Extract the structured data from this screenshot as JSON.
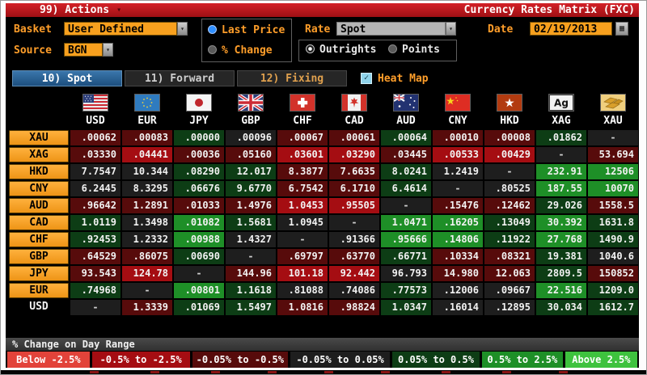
{
  "title_bar": {
    "actions_label": "99) Actions",
    "title": "Currency Rates Matrix (FXC)"
  },
  "controls": {
    "basket_label": "Basket",
    "basket_value": "User Defined",
    "source_label": "Source",
    "source_value": "BGN",
    "price_mode": [
      {
        "label": "Last Price",
        "selected": true
      },
      {
        "label": "% Change",
        "selected": false
      }
    ],
    "rate_label": "Rate",
    "rate_value": "Spot",
    "rate_mode": [
      {
        "label": "Outrights",
        "selected": true
      },
      {
        "label": "Points",
        "selected": false
      }
    ],
    "date_label": "Date",
    "date_value": "02/19/2013"
  },
  "tabs": [
    {
      "name": "tab-spot",
      "label": "10) Spot",
      "active": true
    },
    {
      "name": "tab-forward",
      "label": "11) Forward",
      "active": false
    },
    {
      "name": "tab-fixing",
      "label": "12) Fixing",
      "active": false
    }
  ],
  "heat_map": {
    "label": "Heat Map",
    "checked": true
  },
  "heat_colors": {
    "r2": "#a50d12",
    "r3": "#570b0b",
    "n": "#1e1e1e",
    "g5": "#0d3d15",
    "g6": "#1e8f27"
  },
  "matrix": {
    "columns": [
      "USD",
      "EUR",
      "JPY",
      "GBP",
      "CHF",
      "CAD",
      "AUD",
      "CNY",
      "HKD",
      "XAG",
      "XAU"
    ],
    "rows": [
      {
        "label": "XAU",
        "style": "button",
        "values": [
          ".00062",
          ".00083",
          ".00000",
          ".00096",
          ".00067",
          ".00061",
          ".00064",
          ".00010",
          ".00008",
          ".01862",
          "-"
        ],
        "heat": [
          "r3",
          "r3",
          "g5",
          "n",
          "r3",
          "r3",
          "g5",
          "r3",
          "r3",
          "g5",
          "n"
        ]
      },
      {
        "label": "XAG",
        "style": "button",
        "values": [
          ".03330",
          ".04441",
          ".00036",
          ".05160",
          ".03601",
          ".03290",
          ".03445",
          ".00533",
          ".00429",
          "-",
          "53.694"
        ],
        "heat": [
          "r3",
          "r2",
          "r3",
          "r3",
          "r2",
          "r2",
          "r3",
          "r2",
          "r2",
          "n",
          "r3"
        ]
      },
      {
        "label": "HKD",
        "style": "button",
        "values": [
          "7.7547",
          "10.344",
          ".08290",
          "12.017",
          "8.3877",
          "7.6635",
          "8.0241",
          "1.2419",
          "-",
          "232.91",
          "12506"
        ],
        "heat": [
          "n",
          "n",
          "g5",
          "g5",
          "r3",
          "r3",
          "g5",
          "n",
          "n",
          "g6",
          "g6"
        ]
      },
      {
        "label": "CNY",
        "style": "button",
        "values": [
          "6.2445",
          "8.3295",
          ".06676",
          "9.6770",
          "6.7542",
          "6.1710",
          "6.4614",
          "-",
          ".80525",
          "187.55",
          "10070"
        ],
        "heat": [
          "n",
          "n",
          "g5",
          "g5",
          "r3",
          "r3",
          "g5",
          "n",
          "n",
          "g6",
          "g6"
        ]
      },
      {
        "label": "AUD",
        "style": "button",
        "values": [
          ".96642",
          "1.2891",
          ".01033",
          "1.4976",
          "1.0453",
          ".95505",
          "-",
          ".15476",
          ".12462",
          "29.026",
          "1558.5"
        ],
        "heat": [
          "r3",
          "r3",
          "r3",
          "r3",
          "r2",
          "r2",
          "n",
          "r3",
          "r3",
          "g5",
          "r3"
        ]
      },
      {
        "label": "CAD",
        "style": "button",
        "values": [
          "1.0119",
          "1.3498",
          ".01082",
          "1.5681",
          "1.0945",
          "-",
          "1.0471",
          ".16205",
          ".13049",
          "30.392",
          "1631.8"
        ],
        "heat": [
          "g5",
          "n",
          "g6",
          "g5",
          "n",
          "n",
          "g6",
          "g6",
          "g5",
          "g6",
          "g5"
        ]
      },
      {
        "label": "CHF",
        "style": "button",
        "values": [
          ".92453",
          "1.2332",
          ".00988",
          "1.4327",
          "-",
          ".91366",
          ".95666",
          ".14806",
          ".11922",
          "27.768",
          "1490.9"
        ],
        "heat": [
          "g5",
          "n",
          "g6",
          "n",
          "n",
          "n",
          "g6",
          "g6",
          "g5",
          "g6",
          "g5"
        ]
      },
      {
        "label": "GBP",
        "style": "button",
        "values": [
          ".64529",
          ".86075",
          ".00690",
          "-",
          ".69797",
          ".63770",
          ".66771",
          ".10334",
          ".08321",
          "19.381",
          "1040.6"
        ],
        "heat": [
          "r3",
          "r3",
          "g5",
          "n",
          "r3",
          "r3",
          "g5",
          "r3",
          "r3",
          "g5",
          "n"
        ]
      },
      {
        "label": "JPY",
        "style": "button",
        "values": [
          "93.543",
          "124.78",
          "-",
          "144.96",
          "101.18",
          "92.442",
          "96.793",
          "14.980",
          "12.063",
          "2809.5",
          "150852"
        ],
        "heat": [
          "r3",
          "r2",
          "n",
          "r3",
          "r2",
          "r2",
          "n",
          "r3",
          "r3",
          "g5",
          "r3"
        ]
      },
      {
        "label": "EUR",
        "style": "button",
        "values": [
          ".74968",
          "-",
          ".00801",
          "1.1618",
          ".81088",
          ".74086",
          ".77573",
          ".12006",
          ".09667",
          "22.516",
          "1209.0"
        ],
        "heat": [
          "g5",
          "n",
          "g6",
          "g5",
          "n",
          "n",
          "g5",
          "n",
          "n",
          "g6",
          "g5"
        ]
      },
      {
        "label": "USD",
        "style": "plain",
        "values": [
          "-",
          "1.3339",
          ".01069",
          "1.5497",
          "1.0816",
          ".98824",
          "1.0347",
          ".16014",
          ".12895",
          "30.034",
          "1612.7"
        ],
        "heat": [
          "n",
          "r3",
          "g5",
          "g5",
          "r3",
          "r3",
          "g5",
          "n",
          "n",
          "g5",
          "g5"
        ]
      }
    ]
  },
  "legend": {
    "header": "% Change on Day Range",
    "items": [
      {
        "label": "Below -2.5%",
        "color": "#e2433a",
        "grow": 97
      },
      {
        "label": "-0.5% to -2.5%",
        "color": "#a50d12",
        "grow": 115
      },
      {
        "label": "-0.05% to -0.5%",
        "color": "#570b0b",
        "grow": 113
      },
      {
        "label": "-0.05% to 0.05%",
        "color": "#1e1e1e",
        "grow": 117
      },
      {
        "label": "0.05% to 0.5%",
        "color": "#0d3d15",
        "grow": 103
      },
      {
        "label": "0.5% to 2.5%",
        "color": "#1e8f27",
        "grow": 95
      },
      {
        "label": "Above 2.5%",
        "color": "#3ec23e",
        "grow": 85
      }
    ]
  }
}
